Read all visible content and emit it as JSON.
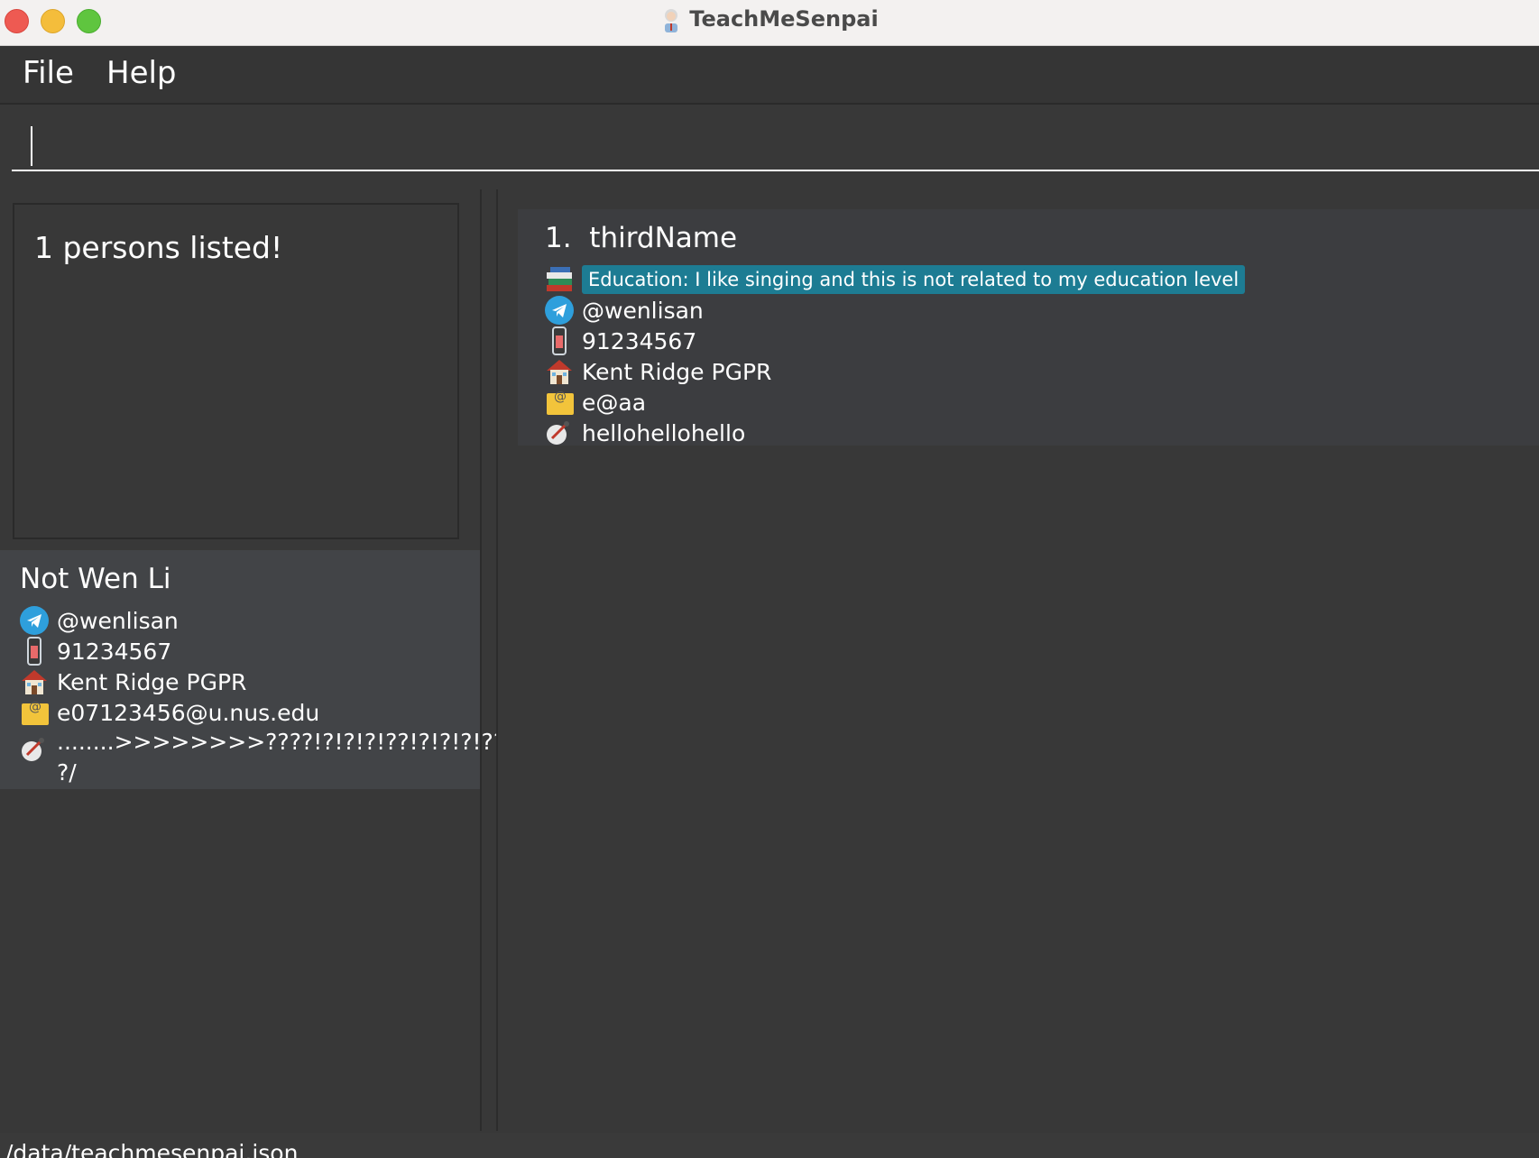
{
  "window": {
    "title": "TeachMeSenpai"
  },
  "menu": {
    "file": "File",
    "help": "Help"
  },
  "command": {
    "value": "",
    "placeholder": ""
  },
  "result": {
    "message": "1 persons listed!"
  },
  "detail": {
    "name": "Not Wen Li",
    "telegram": "@wenlisan",
    "phone": "91234567",
    "address": "Kent Ridge PGPR",
    "email": "e07123456@u.nus.edu",
    "remark_line1": "........>>>>>>>>????!?!?!?!??!?!?!?!??!?!?!",
    "remark_line2": "?/"
  },
  "list": {
    "items": [
      {
        "index": "1.",
        "name": "thirdName",
        "education": "Education: I like singing and this is not related to my education level",
        "telegram": "@wenlisan",
        "phone": "91234567",
        "address": "Kent Ridge PGPR",
        "email": "e@aa",
        "remark": "hellohellohello"
      }
    ]
  },
  "status": {
    "path": "/data/teachmesenpai.json"
  },
  "colors": {
    "background": "#383838",
    "tag": "#1d7c93",
    "card": "#3c3d40",
    "detail_card": "#424447"
  }
}
